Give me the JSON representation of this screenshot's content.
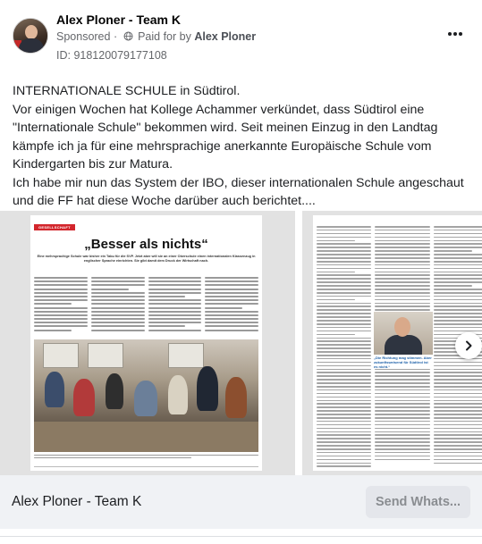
{
  "post": {
    "page_name": "Alex Ploner - Team K",
    "sponsored_label": "Sponsored",
    "paid_for_prefix": "Paid for by",
    "advertiser": "Alex Ploner",
    "ad_id": "ID: 918120079177108",
    "more_icon": "more-options-icon",
    "text_lines": [
      "INTERNATIONALE SCHULE in Südtirol.",
      "Vor einigen Wochen hat Kollege Achammer verkündet, dass Südtirol eine",
      "\"Internationale Schule\" bekommen wird. Seit meinen Einzug in den Landtag",
      "kämpfe ich ja für eine mehrsprachige anerkannte Europäische Schule vom",
      "Kindergarten bis zur Matura.",
      "Ich habe mir nun das System der IBO, dieser internationalen Schule angeschaut",
      "und die FF hat diese Woche darüber auch berichtet...."
    ]
  },
  "carousel": {
    "slide1": {
      "section_tag": "GESELLSCHAFT",
      "headline": "„Besser als nichts“",
      "subhead": "Eine mehrsprachige Schule war bisher ein Tabu für die SVP. Jetzt aber will sie an einer Oberschule einen internationalen Klassenzug in englischer Sprache einrichten. Sie gibt damit dem Druck der Wirtschaft nach."
    },
    "slide2": {
      "quote": "„Die Richtung mag stimmen. Aber zukunftsweisend für Südtirol ist es nicht.“"
    },
    "next_icon": "chevron-right-icon"
  },
  "cta": {
    "title": "Alex Ploner - Team K",
    "button_label": "Send Whats..."
  },
  "colors": {
    "cta_background": "#f0f2f5",
    "button_background": "#e4e6eb",
    "section_tag": "#d3262c"
  }
}
